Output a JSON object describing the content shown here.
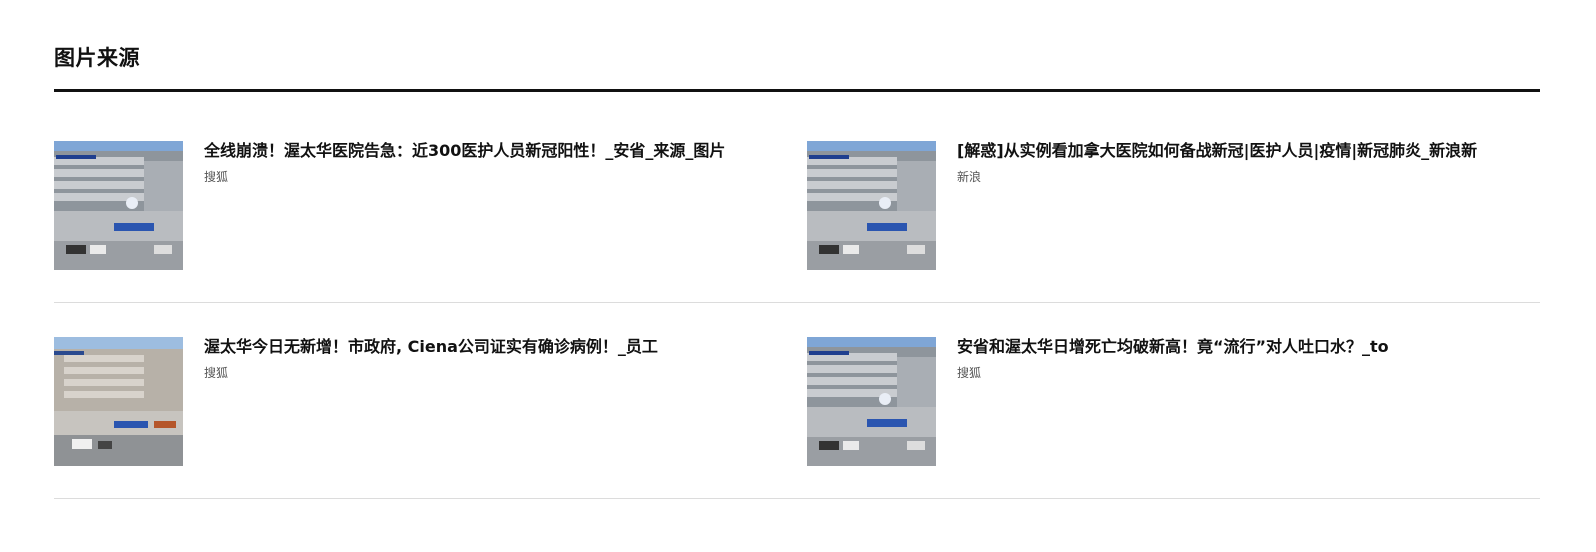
{
  "section": {
    "title": "图片来源"
  },
  "articles": [
    {
      "title": "全线崩溃！渥太华医院告急：近300医护人员新冠阳性！_安省_来源_图片",
      "source": "搜狐",
      "thumb_icon": "hospital-building-photo"
    },
    {
      "title": "[解惑]从实例看加拿大医院如何备战新冠|医护人员|疫情|新冠肺炎_新浪新",
      "source": "新浪",
      "thumb_icon": "hospital-building-photo"
    },
    {
      "title": "渥太华今日无新增！市政府, Ciena公司证实有确诊病例！_员工",
      "source": "搜狐",
      "thumb_icon": "hospital-building-photo"
    },
    {
      "title": "安省和渥太华日增死亡均破新高！竟“流行”对人吐口水？_to",
      "source": "搜狐",
      "thumb_icon": "hospital-building-photo"
    }
  ],
  "colors": {
    "title_rule": "#111111",
    "divider": "#dcdcdc",
    "source_text": "#555555"
  }
}
